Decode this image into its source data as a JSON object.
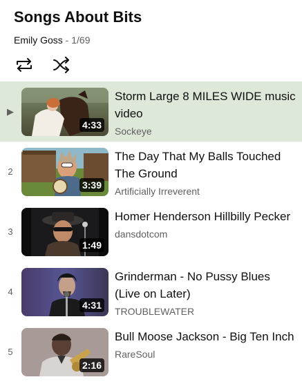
{
  "playlist": {
    "title": "Songs About Bits",
    "owner": "Emily Goss",
    "separator": " - ",
    "position": "1/69"
  },
  "controls": {
    "loop_icon": "loop-icon",
    "shuffle_icon": "shuffle-icon"
  },
  "items": [
    {
      "index": "▶",
      "title": "Storm Large 8 MILES WIDE music video",
      "channel": "Sockeye",
      "duration": "4:33",
      "active": true
    },
    {
      "index": "2",
      "title": "The Day That My Balls Touched The Ground",
      "channel": "Artificially Irreverent",
      "duration": "3:39",
      "active": false
    },
    {
      "index": "3",
      "title": "Homer Henderson Hillbilly Pecker",
      "channel": "dansdotcom",
      "duration": "1:49",
      "active": false
    },
    {
      "index": "4",
      "title": "Grinderman - No Pussy Blues (Live on Later)",
      "channel": "TROUBLEWATER",
      "duration": "4:31",
      "active": false
    },
    {
      "index": "5",
      "title": "Bull Moose Jackson - Big Ten Inch",
      "channel": "RareSoul",
      "duration": "2:16",
      "active": false
    }
  ],
  "colors": {
    "active_row_bg": "#dde8d8",
    "text_primary": "#0f0f0f",
    "text_secondary": "#606060"
  }
}
